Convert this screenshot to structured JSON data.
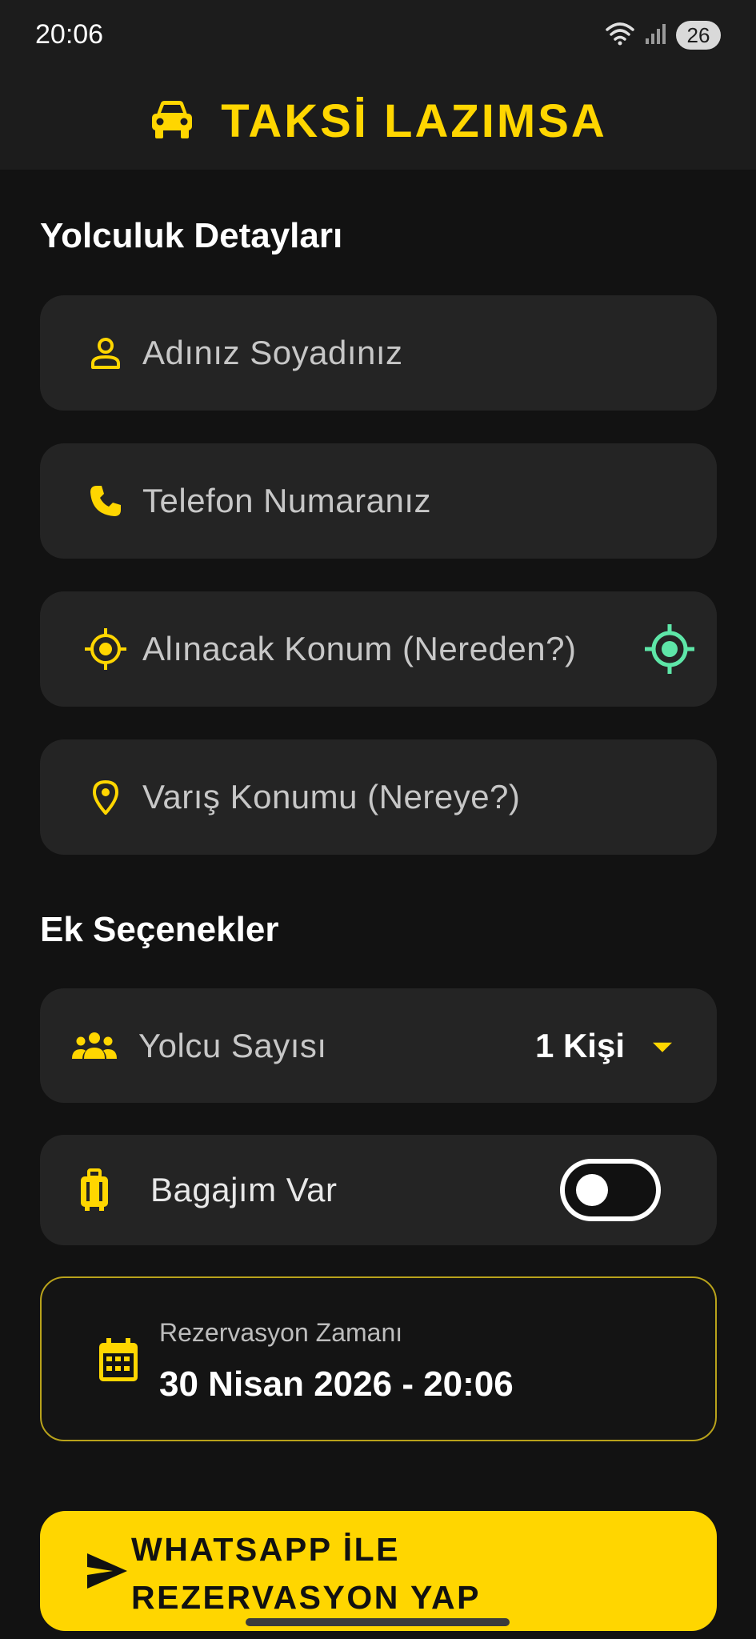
{
  "status_bar": {
    "time": "20:06",
    "battery": "26",
    "icons": [
      "wifi-icon",
      "signal-icon",
      "battery-icon"
    ]
  },
  "header": {
    "title": "TAKSİ LAZIMSA",
    "icon": "car-icon"
  },
  "colors": {
    "accent": "#ffd600",
    "location_accent": "#5ee6a8",
    "background": "#121212",
    "card": "#242424"
  },
  "trip_details": {
    "title": "Yolculuk Detayları",
    "fields": [
      {
        "icon": "person-icon",
        "placeholder": "Adınız Soyadınız"
      },
      {
        "icon": "phone-icon",
        "placeholder": "Telefon Numaranız"
      },
      {
        "icon": "target-icon",
        "placeholder": "Alınacak Konum (Nereden?)",
        "trailing_icon": "my-location-icon"
      },
      {
        "icon": "location-pin-icon",
        "placeholder": "Varış Konumu (Nereye?)"
      }
    ]
  },
  "extra_options": {
    "title": "Ek Seçenekler",
    "passengers": {
      "icon": "group-icon",
      "label": "Yolcu Sayısı",
      "value": "1 Kişi"
    },
    "luggage": {
      "icon": "luggage-icon",
      "label": "Bagajım Var",
      "enabled": false
    }
  },
  "reservation": {
    "icon": "calendar-icon",
    "label": "Rezervasyon Zamanı",
    "value": "30 Nisan 2026 - 20:06"
  },
  "submit": {
    "icon": "send-icon",
    "label": "WHATSAPP İLE\nREZERVASYON YAP"
  }
}
